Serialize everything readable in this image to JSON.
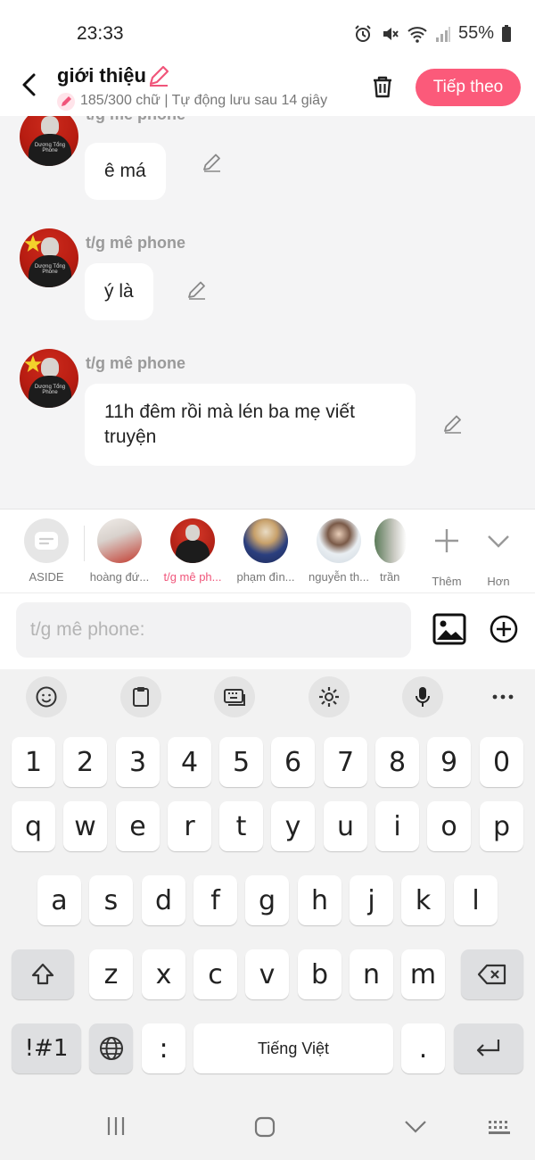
{
  "status": {
    "time": "23:33",
    "battery": "55%"
  },
  "header": {
    "title": "giới thiệu",
    "subtitle": "185/300 chữ | Tự động lưu sau 14 giây",
    "next_label": "Tiếp theo"
  },
  "messages": [
    {
      "sender": "t/g mê phone",
      "text": "ê má"
    },
    {
      "sender": "t/g mê phone",
      "text": "ý là"
    },
    {
      "sender": "t/g mê phone",
      "text": "11h đêm rồi mà lén ba mẹ viết truyện"
    }
  ],
  "avatar_shirt_text": "Dương Tổng Phone",
  "characters": [
    {
      "label": "ASIDE"
    },
    {
      "label": "hoàng đứ..."
    },
    {
      "label": "t/g mê ph..."
    },
    {
      "label": "phạm đìn..."
    },
    {
      "label": "nguyễn th..."
    },
    {
      "label": "trần"
    },
    {
      "label": "Thêm"
    },
    {
      "label": "Hơn"
    }
  ],
  "input": {
    "placeholder": "t/g mê phone:"
  },
  "keyboard": {
    "row1": [
      "1",
      "2",
      "3",
      "4",
      "5",
      "6",
      "7",
      "8",
      "9",
      "0"
    ],
    "row2": [
      "q",
      "w",
      "e",
      "r",
      "t",
      "y",
      "u",
      "i",
      "o",
      "p"
    ],
    "row3": [
      "a",
      "s",
      "d",
      "f",
      "g",
      "h",
      "j",
      "k",
      "l"
    ],
    "row4": [
      "z",
      "x",
      "c",
      "v",
      "b",
      "n",
      "m"
    ],
    "sym_label": "!#1",
    "colon": ":",
    "space_label": "Tiếng Việt",
    "period": "."
  },
  "colors": {
    "accent": "#fb5a7a",
    "chat_bg": "#f4f4f5"
  }
}
